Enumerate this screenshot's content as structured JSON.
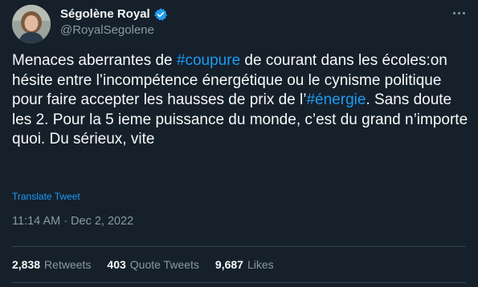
{
  "author": {
    "display_name": "Ségolène Royal",
    "handle": "@RoyalSegolene",
    "verified_icon": "verified-badge-icon",
    "avatar_icon": "avatar"
  },
  "more_icon": "more-options-icon",
  "tweet": {
    "segments": [
      {
        "text": "Menaces aberrantes de ",
        "hashtag": false
      },
      {
        "text": "#coupure",
        "hashtag": true
      },
      {
        "text": " de courant dans les écoles:on hésite entre l’incompétence énergétique ou le cynisme politique pour faire accepter les hausses de prix de l’",
        "hashtag": false
      },
      {
        "text": "#énergie",
        "hashtag": true
      },
      {
        "text": ". Sans doute les 2. Pour la 5 ieme puissance du monde, c’est du grand n’importe quoi. Du sérieux, vite",
        "hashtag": false
      }
    ],
    "translate_label": "Translate Tweet",
    "time": "11:14 AM",
    "separator": "·",
    "date": "Dec 2, 2022"
  },
  "stats": [
    {
      "count": "2,838",
      "label": "Retweets"
    },
    {
      "count": "403",
      "label": "Quote Tweets"
    },
    {
      "count": "9,687",
      "label": "Likes"
    }
  ],
  "colors": {
    "background": "#15202b",
    "text": "#f7f9f9",
    "secondary": "#8b98a5",
    "accent": "#1d9bf0",
    "divider": "#38444d"
  }
}
